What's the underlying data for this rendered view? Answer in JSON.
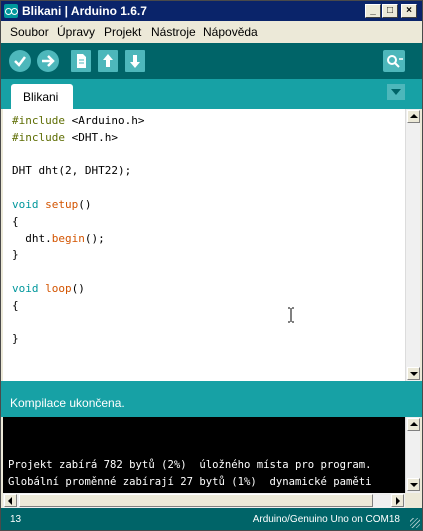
{
  "window": {
    "title": "Blikani | Arduino 1.6.7"
  },
  "menu": [
    "Soubor",
    "Úpravy",
    "Projekt",
    "Nástroje",
    "Nápověda"
  ],
  "toolbar": {
    "icons": [
      "verify-icon",
      "upload-icon",
      "new-icon",
      "open-icon",
      "save-icon",
      "serial-monitor-icon"
    ]
  },
  "tabs": [
    "Blikani"
  ],
  "editor": {
    "lines": [
      [
        {
          "t": "#include ",
          "c": "kw"
        },
        {
          "t": "<Arduino.h>",
          "c": ""
        }
      ],
      [
        {
          "t": "#include ",
          "c": "kw"
        },
        {
          "t": "<DHT.h>",
          "c": ""
        }
      ],
      [],
      [
        {
          "t": "DHT dht(2, DHT22);",
          "c": ""
        }
      ],
      [],
      [
        {
          "t": "void",
          "c": "type"
        },
        {
          "t": " ",
          "c": ""
        },
        {
          "t": "setup",
          "c": "func"
        },
        {
          "t": "()",
          "c": ""
        }
      ],
      [
        {
          "t": "{",
          "c": ""
        }
      ],
      [
        {
          "t": "  dht.",
          "c": ""
        },
        {
          "t": "begin",
          "c": "func"
        },
        {
          "t": "();",
          "c": ""
        }
      ],
      [
        {
          "t": "}",
          "c": ""
        }
      ],
      [],
      [
        {
          "t": "void",
          "c": "type"
        },
        {
          "t": " ",
          "c": ""
        },
        {
          "t": "loop",
          "c": "func"
        },
        {
          "t": "()",
          "c": ""
        }
      ],
      [
        {
          "t": "{",
          "c": ""
        }
      ],
      [],
      [
        {
          "t": "}",
          "c": ""
        }
      ]
    ]
  },
  "status": {
    "message": "Kompilace ukončena."
  },
  "console": {
    "lines": [
      "Projekt zabírá 782 bytů (2%)  úložného místa pro program.",
      "Globální proměnné zabírají 27 bytů (1%)  dynamické paměti"
    ]
  },
  "footer": {
    "line_number": "13",
    "board": "Arduino/Genuino Uno on COM18"
  },
  "colors": {
    "toolbar_bg": "#006468",
    "tab_strip_bg": "#17a1a5",
    "keyword": "#5e6d03",
    "type": "#00979c",
    "function": "#d35400"
  }
}
